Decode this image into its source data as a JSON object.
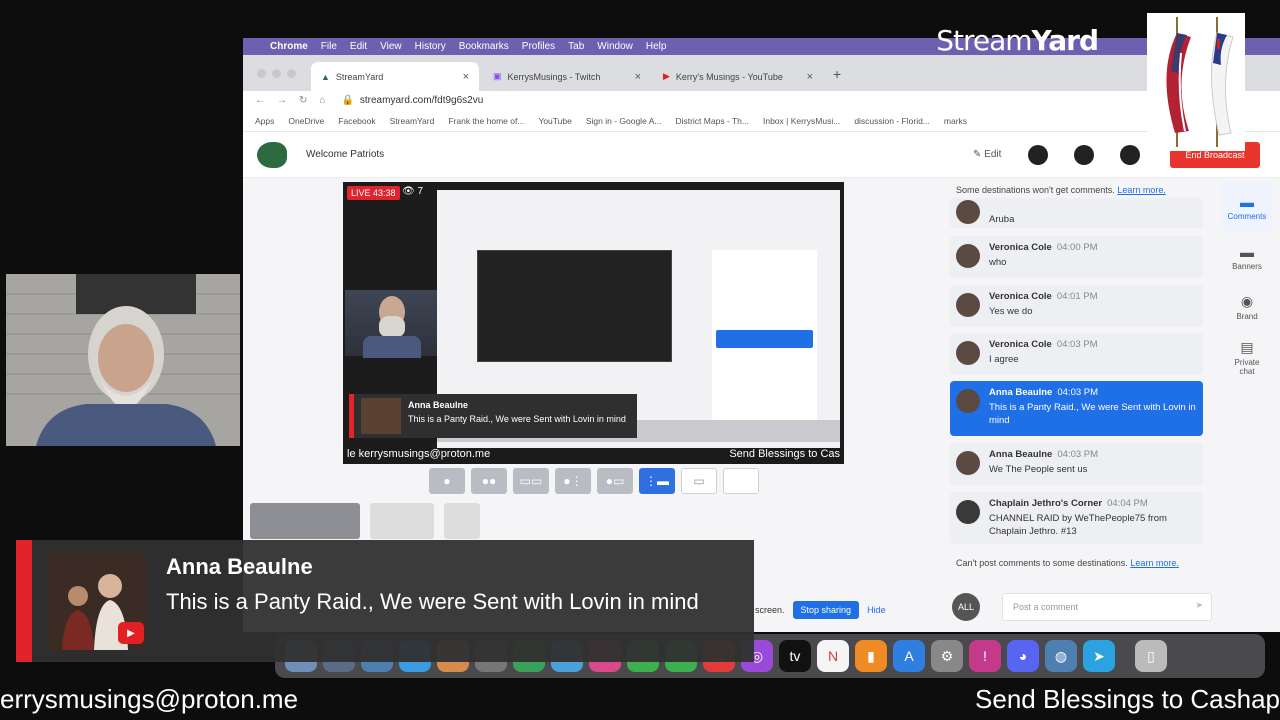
{
  "menubar": {
    "app": "Chrome",
    "items": [
      "File",
      "Edit",
      "View",
      "History",
      "Bookmarks",
      "Profiles",
      "Tab",
      "Window",
      "Help"
    ]
  },
  "brand": {
    "text_a": "Stream",
    "text_b": "Yard"
  },
  "tabs": [
    {
      "label": "StreamYard"
    },
    {
      "label": "KerrysMusings - Twitch"
    },
    {
      "label": "Kerry's Musings - YouTube"
    }
  ],
  "address": {
    "url": "streamyard.com/fdt9g6s2vu"
  },
  "bookmarks": [
    "Apps",
    "OneDrive",
    "Facebook",
    "StreamYard",
    "Frank the home of...",
    "YouTube",
    "Sign in - Google A...",
    "District Maps - Th...",
    "Inbox | KerrysMusi...",
    "discussion - Florid...",
    "marks"
  ],
  "studio": {
    "title": "Welcome Patriots",
    "edit_label": "Edit",
    "end_label": "End Broadcast",
    "live_badge": "LIVE 43:38",
    "viewer_count": "7",
    "stage_banner_name": "Anna Beaulne",
    "stage_banner_text": "This is a Panty Raid., We were Sent with Lovin in mind",
    "stage_ticker_left": "le kerrysmusings@proton.me",
    "stage_ticker_right": "Send Blessings to Cas",
    "share_text": "screen.",
    "stop_sharing": "Stop sharing",
    "hide": "Hide"
  },
  "chat": {
    "notice_top": "Some destinations won't get comments.",
    "learn_more": "Learn more.",
    "messages": [
      {
        "name": "Veronica Cole",
        "time": "04:00 PM",
        "text": "Aruba"
      },
      {
        "name": "Veronica Cole",
        "time": "04:00 PM",
        "text": "who"
      },
      {
        "name": "Veronica Cole",
        "time": "04:01 PM",
        "text": "Yes we do"
      },
      {
        "name": "Veronica Cole",
        "time": "04:03 PM",
        "text": "I agree"
      },
      {
        "name": "Anna Beaulne",
        "time": "04:03 PM",
        "text": "This is a Panty Raid., We were Sent with Lovin in mind"
      },
      {
        "name": "Anna Beaulne",
        "time": "04:03 PM",
        "text": "We The People sent us"
      },
      {
        "name": "Chaplain Jethro's Corner",
        "time": "04:04 PM",
        "text": "CHANNEL RAID by WeThePeople75 from Chaplain Jethro. #13"
      }
    ],
    "notice_bottom": "Can't post comments to some destinations.",
    "learn_more_2": "Learn more.",
    "audience": "ALL",
    "post_placeholder": "Post a comment"
  },
  "rail": [
    "Comments",
    "Banners",
    "Brand",
    "Private chat"
  ],
  "overlay": {
    "name": "Anna Beaulne",
    "text": "This is a Panty Raid., We were Sent with Lovin in mind"
  },
  "ticker": {
    "left": "errysmusings@proton.me",
    "right": "Send Blessings to Cashap"
  },
  "colors": {
    "accent": "#1f6fe7",
    "live": "#e0242e",
    "menubar": "#6e5fb0"
  }
}
